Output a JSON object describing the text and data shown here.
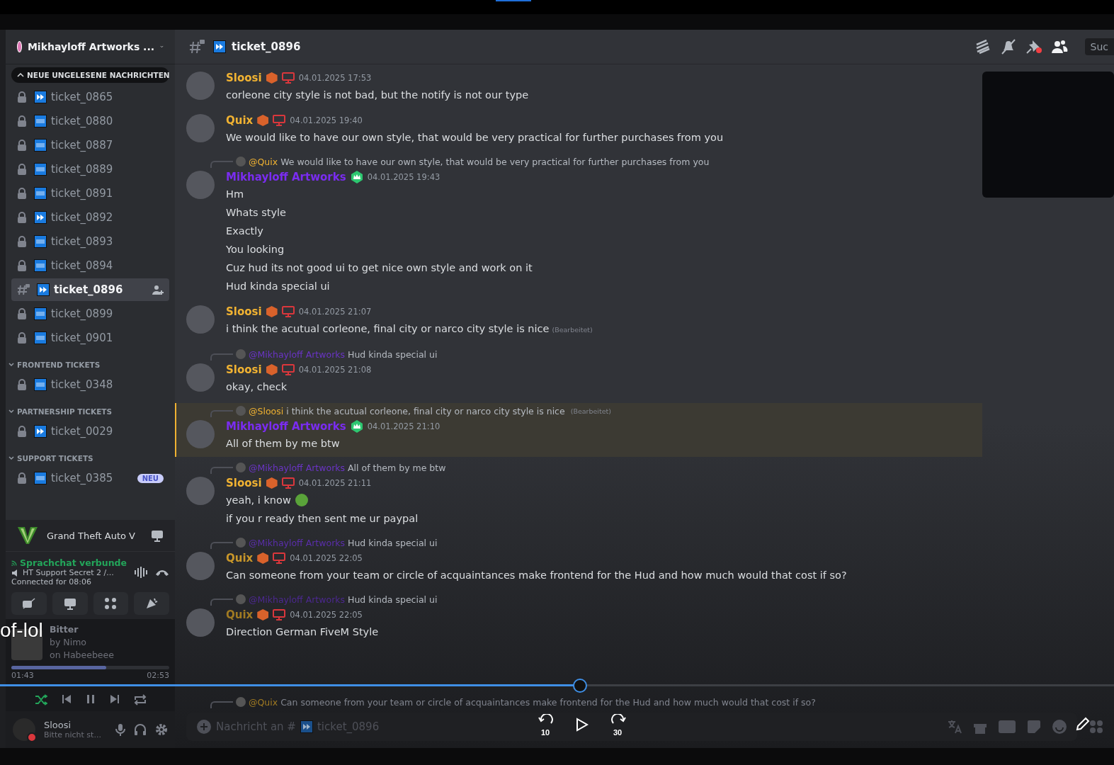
{
  "server": {
    "name": "Mikhayloff Artworks ..."
  },
  "unread_banner": "NEUE UNGELESENE NACHRICHTEN",
  "channels": [
    {
      "name": "ticket_0865",
      "kind": "locked",
      "new_tag": false,
      "selected": false
    },
    {
      "name": "ticket_0880",
      "kind": "locked",
      "new_tag": true,
      "selected": false
    },
    {
      "name": "ticket_0887",
      "kind": "locked",
      "new_tag": true,
      "selected": false
    },
    {
      "name": "ticket_0889",
      "kind": "locked",
      "new_tag": true,
      "selected": false
    },
    {
      "name": "ticket_0891",
      "kind": "locked",
      "new_tag": true,
      "selected": false
    },
    {
      "name": "ticket_0892",
      "kind": "locked",
      "new_tag": false,
      "selected": false
    },
    {
      "name": "ticket_0893",
      "kind": "locked",
      "new_tag": true,
      "selected": false
    },
    {
      "name": "ticket_0894",
      "kind": "locked",
      "new_tag": true,
      "selected": false
    },
    {
      "name": "ticket_0896",
      "kind": "hash",
      "new_tag": false,
      "selected": true
    },
    {
      "name": "ticket_0899",
      "kind": "locked",
      "new_tag": true,
      "selected": false
    },
    {
      "name": "ticket_0901",
      "kind": "locked",
      "new_tag": true,
      "selected": false
    }
  ],
  "categories": [
    {
      "name": "FRONTEND TICKETS",
      "channels": [
        {
          "name": "ticket_0348",
          "kind": "locked",
          "new_tag": true,
          "selected": false
        }
      ]
    },
    {
      "name": "PARTNERSHIP TICKETS",
      "channels": [
        {
          "name": "ticket_0029",
          "kind": "locked",
          "new_tag": false,
          "selected": false
        }
      ]
    },
    {
      "name": "SUPPORT TICKETS",
      "channels": [
        {
          "name": "ticket_0385",
          "kind": "locked",
          "new_tag": true,
          "selected": false,
          "badge": "NEU"
        }
      ]
    }
  ],
  "activity": {
    "game": "Grand Theft Auto V"
  },
  "voice": {
    "status": "Sprachchat verbunde",
    "channel": "HT Support Secret 2 /...",
    "duration": "Connected for 08:06"
  },
  "music": {
    "title": "Bitter",
    "artist": "by Nimo",
    "album": "on Habeebeee",
    "level": 0.6,
    "elapsed": "01:43",
    "total": "02:53",
    "shuffle_on": true
  },
  "user": {
    "name": "Sloosi",
    "status": "Bitte nicht st..."
  },
  "overlay_caption": "of-lol",
  "header": {
    "channel": "ticket_0896",
    "search": "Suc"
  },
  "messages": [
    {
      "author": "Sloosi",
      "color": "#f0b232",
      "badges": true,
      "time": "04.01.2025 17:53",
      "lines": [
        "corleone city style is not bad, but the notify is not our type"
      ],
      "emoji": false,
      "highlighted": false
    },
    {
      "author": "Quix",
      "color": "#f0b232",
      "badges": true,
      "time": "04.01.2025 19:40",
      "lines": [
        "We would like to have our own style, that would be very practical for further purchases from you"
      ],
      "emoji": false,
      "highlighted": false
    },
    {
      "reply": {
        "mention": "@Quix",
        "color": "#f0b232",
        "text": "We would like to have our own style, that would be very practical for further purchases from you"
      },
      "author": "Mikhayloff Artworks",
      "color": "#7a2cf0",
      "badges": false,
      "time": "04.01.2025 19:43",
      "lines": [
        "Hm",
        "Whats style",
        "Exactly",
        "You looking",
        "Cuz hud its not good ui to get nice own style and work on it",
        "Hud kinda special ui"
      ],
      "emoji": false,
      "highlighted": false
    },
    {
      "author": "Sloosi",
      "color": "#f0b232",
      "badges": true,
      "time": "04.01.2025 21:07",
      "lines": [
        "i think the acutual corleone, final city or narco city style is nice"
      ],
      "edited_label": "(Bearbeitet)",
      "emoji": false,
      "highlighted": false
    },
    {
      "reply": {
        "mention": "@Mikhayloff Artworks",
        "color": "#6a34c4",
        "text": "Hud kinda special ui"
      },
      "author": "Sloosi",
      "color": "#f0b232",
      "badges": true,
      "time": "04.01.2025 21:08",
      "lines": [
        "okay, check"
      ],
      "emoji": false,
      "highlighted": false
    },
    {
      "reply": {
        "mention": "@Sloosi",
        "color": "#f0b232",
        "text": "i think the acutual corleone, final city or narco city style is nice",
        "edited_label": "(Bearbeitet)"
      },
      "author": "Mikhayloff Artworks",
      "color": "#7a2cf0",
      "badges": false,
      "time": "04.01.2025 21:10",
      "lines": [
        "All of them by me btw"
      ],
      "emoji": false,
      "highlighted": true
    },
    {
      "reply": {
        "mention": "@Mikhayloff Artworks",
        "color": "#6a34c4",
        "text": "All of them by me btw"
      },
      "author": "Sloosi",
      "color": "#f0b232",
      "badges": true,
      "time": "04.01.2025 21:11",
      "lines": [
        "yeah, i know",
        "if you r ready then sent me ur paypal"
      ],
      "emoji": true,
      "highlighted": false
    },
    {
      "reply": {
        "mention": "@Mikhayloff Artworks",
        "color": "#5a2eaa",
        "text": "Hud kinda special ui"
      },
      "author": "Quix",
      "color": "#c9972a",
      "badges": true,
      "time": "04.01.2025 22:05",
      "lines": [
        "Can someone from your team or circle of acquaintances make frontend for the Hud and how much would that cost if so?"
      ],
      "emoji": false,
      "highlighted": false
    },
    {
      "reply": {
        "mention": "@Mikhayloff Artworks",
        "color": "#4c2890",
        "text": "Hud kinda special ui"
      },
      "author": "Quix",
      "color": "#a07a22",
      "badges": true,
      "time": "04.01.2025 22:05",
      "lines": [
        "Direction German FiveM Style"
      ],
      "emoji": false,
      "highlighted": false
    }
  ],
  "trailing_reply": {
    "mention": "@Quix",
    "color": "#a07a22",
    "text": "Can someone from your team or circle of acquaintances make frontend for the Hud and how much would that cost if so?"
  },
  "composer": {
    "placeholder": "Nachricht an #",
    "channel": "ticket_0896"
  },
  "video": {
    "level": 0.52,
    "rewind": "10",
    "forward": "30"
  }
}
